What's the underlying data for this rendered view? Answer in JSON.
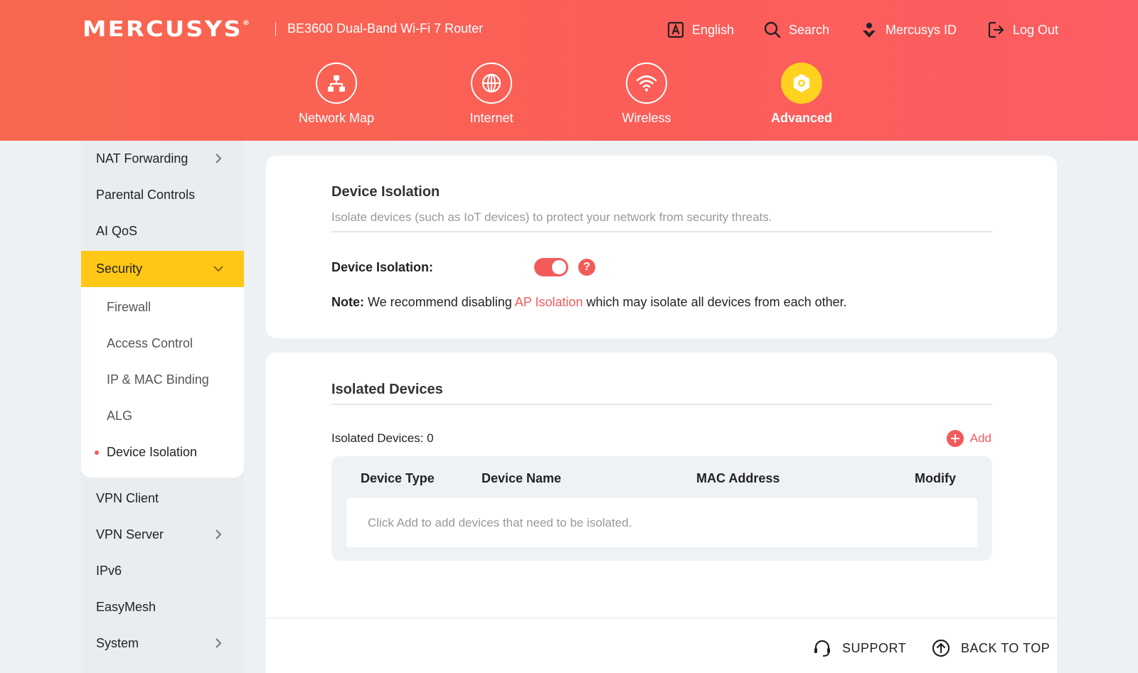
{
  "header": {
    "logo": "MERCUSYS",
    "logo_mark": "®",
    "model": "BE3600 Dual-Band Wi-Fi 7 Router",
    "links": [
      {
        "label": "English",
        "icon": "language-icon"
      },
      {
        "label": "Search",
        "icon": "search-icon"
      },
      {
        "label": "Mercusys ID",
        "icon": "mercusys-id-icon"
      },
      {
        "label": "Log Out",
        "icon": "logout-icon"
      }
    ],
    "nav": [
      {
        "label": "Network Map",
        "icon": "network-map-icon"
      },
      {
        "label": "Internet",
        "icon": "globe-icon"
      },
      {
        "label": "Wireless",
        "icon": "wifi-icon"
      },
      {
        "label": "Advanced",
        "icon": "gear-icon",
        "active": true
      }
    ]
  },
  "sidebar": {
    "items_top": [
      {
        "label": "NAT Forwarding",
        "expandable": true
      },
      {
        "label": "Parental Controls"
      },
      {
        "label": "AI QoS"
      }
    ],
    "selected": {
      "label": "Security",
      "expanded": true
    },
    "sub_items": [
      {
        "label": "Firewall"
      },
      {
        "label": "Access Control"
      },
      {
        "label": "IP & MAC Binding"
      },
      {
        "label": "ALG"
      },
      {
        "label": "Device Isolation",
        "current": true
      }
    ],
    "items_bottom": [
      {
        "label": "VPN Client"
      },
      {
        "label": "VPN Server",
        "expandable": true
      },
      {
        "label": "IPv6"
      },
      {
        "label": "EasyMesh"
      },
      {
        "label": "System",
        "expandable": true
      }
    ]
  },
  "device_isolation": {
    "title": "Device Isolation",
    "description": "Isolate devices (such as IoT devices) to protect your network from security threats.",
    "toggle_label": "Device Isolation:",
    "toggle_on": true,
    "help": "?",
    "note_prefix": "Note:",
    "note_before": " We recommend disabling ",
    "note_link": "AP Isolation",
    "note_after": " which may isolate all devices from each other."
  },
  "isolated_devices": {
    "title": "Isolated Devices",
    "count_label": "Isolated Devices: 0",
    "add_label": "Add",
    "columns": [
      "Device Type",
      "Device Name",
      "MAC Address",
      "Modify"
    ],
    "empty_message": "Click Add to add devices that need to be isolated."
  },
  "footer": {
    "support": "SUPPORT",
    "back_to_top": "BACK TO TOP"
  },
  "colors": {
    "header_gradient_start": "#f8674f",
    "header_gradient_end": "#fb5d62",
    "accent_red": "#f35b5b",
    "active_yellow": "#ffc716"
  }
}
